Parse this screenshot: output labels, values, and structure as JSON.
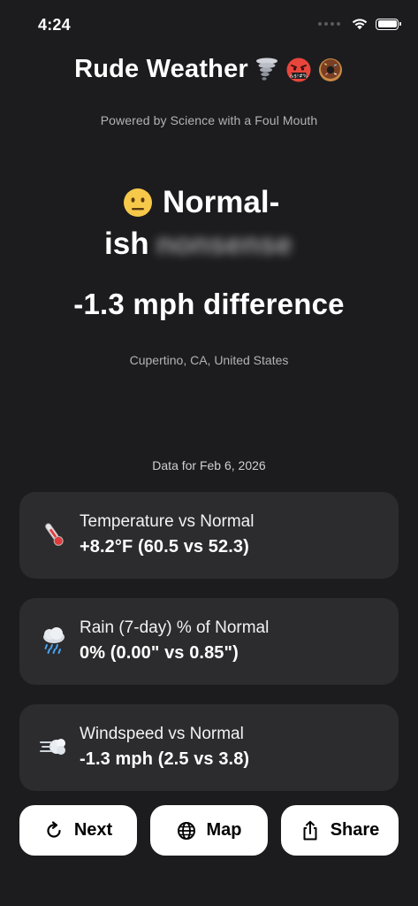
{
  "status_bar": {
    "time": "4:24",
    "icons": [
      "signal-dots-icon",
      "wifi-icon",
      "battery-icon"
    ]
  },
  "header": {
    "title": "Rude Weather",
    "title_emojis": [
      "tornado-icon",
      "cursing-face-icon",
      "donut-icon"
    ],
    "subtitle": "Powered by Science with a Foul Mouth"
  },
  "summary": {
    "emoji": "neutral-face-icon",
    "headline_part1": "Normal-",
    "headline_part2": "ish",
    "censored_word": "nonsense",
    "difference": "-1.3 mph difference",
    "location": "Cupertino, CA, United States",
    "data_date": "Data for Feb 6, 2026"
  },
  "cards": [
    {
      "icon": "thermometer-icon",
      "label": "Temperature vs Normal",
      "value": "+8.2°F (60.5 vs 52.3)"
    },
    {
      "icon": "rain-cloud-icon",
      "label": "Rain (7-day) % of Normal",
      "value": "0% (0.00\" vs 0.85\")"
    },
    {
      "icon": "wind-icon",
      "label": "Windspeed vs Normal",
      "value": "-1.3 mph (2.5 vs 3.8)"
    }
  ],
  "actions": {
    "next_label": "Next",
    "map_label": "Map",
    "share_label": "Share"
  },
  "colors": {
    "background": "#1c1c1e",
    "card": "#2c2c2e",
    "button": "#ffffff"
  }
}
